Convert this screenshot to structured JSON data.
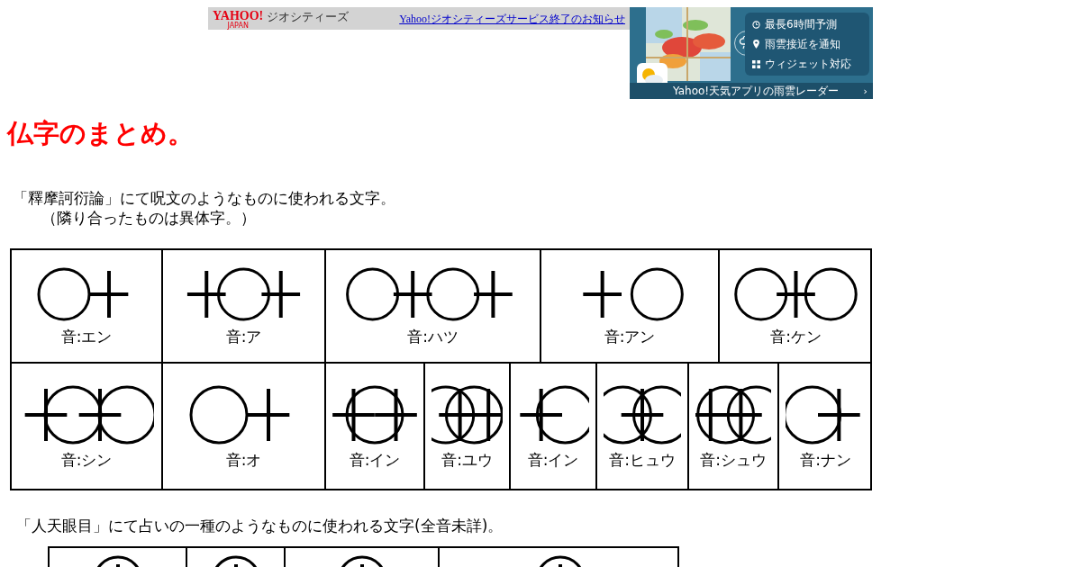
{
  "banner": {
    "logo": "YAHOO!",
    "logo_sub": "JAPAN",
    "service": "ジオシティーズ",
    "notice_link": "Yahoo!ジオシティーズサービス終了のお知らせ"
  },
  "ad": {
    "features": [
      {
        "kind": "clock",
        "label": "最長6時間予測"
      },
      {
        "kind": "pin",
        "label": "雨雲接近を通知"
      },
      {
        "kind": "widget",
        "label": "ウィジェット対応"
      }
    ],
    "cta": "Yahoo!天気アプリの雨雲レーダー",
    "chevron": "›"
  },
  "heading": "仏字のまとめ。",
  "intro": [
    "「釋摩訶衍論」にて呪文のようなものに使われる文字。",
    "（隣り合ったものは異体字。）"
  ],
  "table_1": {
    "upper_row": [
      {
        "kind": "picture",
        "reading": "音:エン"
      },
      {
        "kind": "picture",
        "reading": "音:ア"
      },
      {
        "kind": "picture",
        "reading": "音:ハツ"
      },
      {
        "kind": "picture",
        "reading": "音:アン"
      },
      {
        "kind": "picture",
        "reading": "音:ケン"
      }
    ],
    "lower_row": [
      {
        "kind": "picture",
        "reading": "音:シン"
      },
      {
        "kind": "picture",
        "reading": "音:オ"
      },
      {
        "kind": "picture",
        "reading": "音:イン"
      },
      {
        "kind": "picture",
        "reading": "音:ユウ"
      },
      {
        "kind": "picture",
        "reading": "音:イン"
      },
      {
        "kind": "picture",
        "reading": "音:ヒュウ"
      },
      {
        "kind": "picture",
        "reading": "音:シュウ"
      },
      {
        "kind": "picture",
        "reading": "音:ナン"
      }
    ]
  },
  "section_2": "「人天眼目」にて占いの一種のようなものに使われる文字(全音未詳)。",
  "table_2": {
    "cells": [
      {
        "kind": "picture"
      },
      {
        "kind": "picture"
      },
      {
        "kind": "picture"
      },
      {
        "kind": "picture"
      }
    ]
  }
}
